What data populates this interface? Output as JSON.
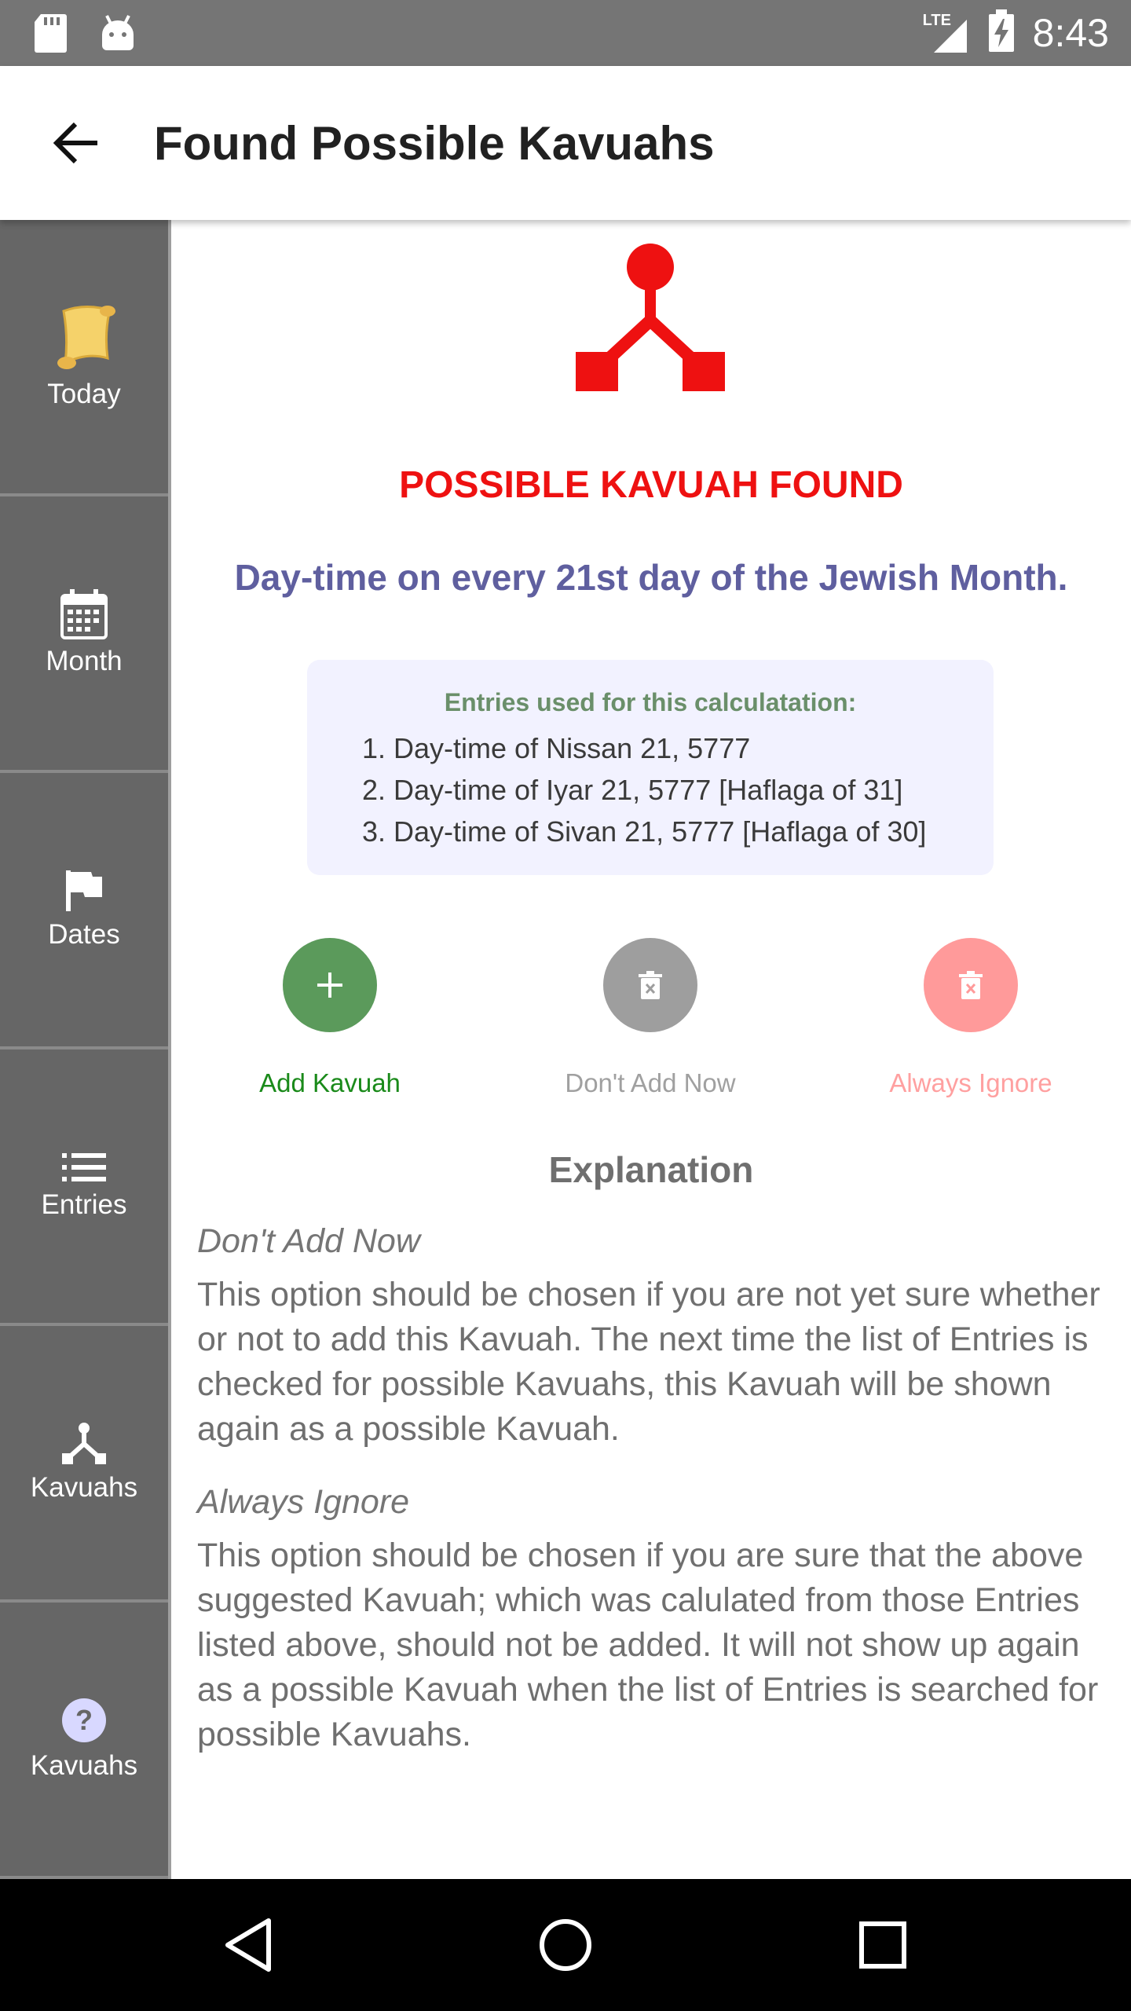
{
  "status_bar": {
    "time": "8:43",
    "network": "LTE"
  },
  "app_bar": {
    "title": "Found Possible Kavuahs"
  },
  "sidebar": {
    "items": [
      {
        "label": "Today",
        "icon": "scroll-icon"
      },
      {
        "label": "Month",
        "icon": "calendar-icon"
      },
      {
        "label": "Dates",
        "icon": "flag-icon"
      },
      {
        "label": "Entries",
        "icon": "list-icon"
      },
      {
        "label": "Kavuahs",
        "icon": "kavuah-icon"
      },
      {
        "label": "Kavuahs",
        "icon": "help-icon"
      }
    ]
  },
  "main": {
    "heading": "POSSIBLE KAVUAH FOUND",
    "description": "Day-time on every 21st day of the Jewish Month.",
    "entries_heading": "Entries used for this calculatation:",
    "entries": [
      "1. Day-time of Nissan 21, 5777",
      "2. Day-time of Iyar 21, 5777 [Haflaga of 31]",
      "3. Day-time of Sivan 21, 5777 [Haflaga of 30]"
    ],
    "actions": {
      "add": "Add Kavuah",
      "dont_add": "Don't Add Now",
      "ignore": "Always Ignore"
    },
    "explanation": {
      "heading": "Explanation",
      "dont_add_title": "Don't Add Now",
      "dont_add_text": "This option should be chosen if you are not yet sure whether or not to add this Kavuah. The next time the list of Entries is checked for possible Kavuahs, this Kavuah will be shown again as a possible Kavuah.",
      "ignore_title": "Always Ignore",
      "ignore_text": "This option should be chosen if you are sure that the above suggested Kavuah; which was calulated from those Entries listed above, should not be added. It will not show up again as a possible Kavuah when the list of Entries is searched for possible Kavuahs."
    }
  },
  "colors": {
    "accent_red": "#ee1111",
    "description_purple": "#5f5f9f",
    "add_green": "#5b9a5b",
    "add_label_green": "#1a8a1a",
    "dont_add_grey": "#9e9e9e",
    "ignore_pink": "#ff9a9a"
  }
}
